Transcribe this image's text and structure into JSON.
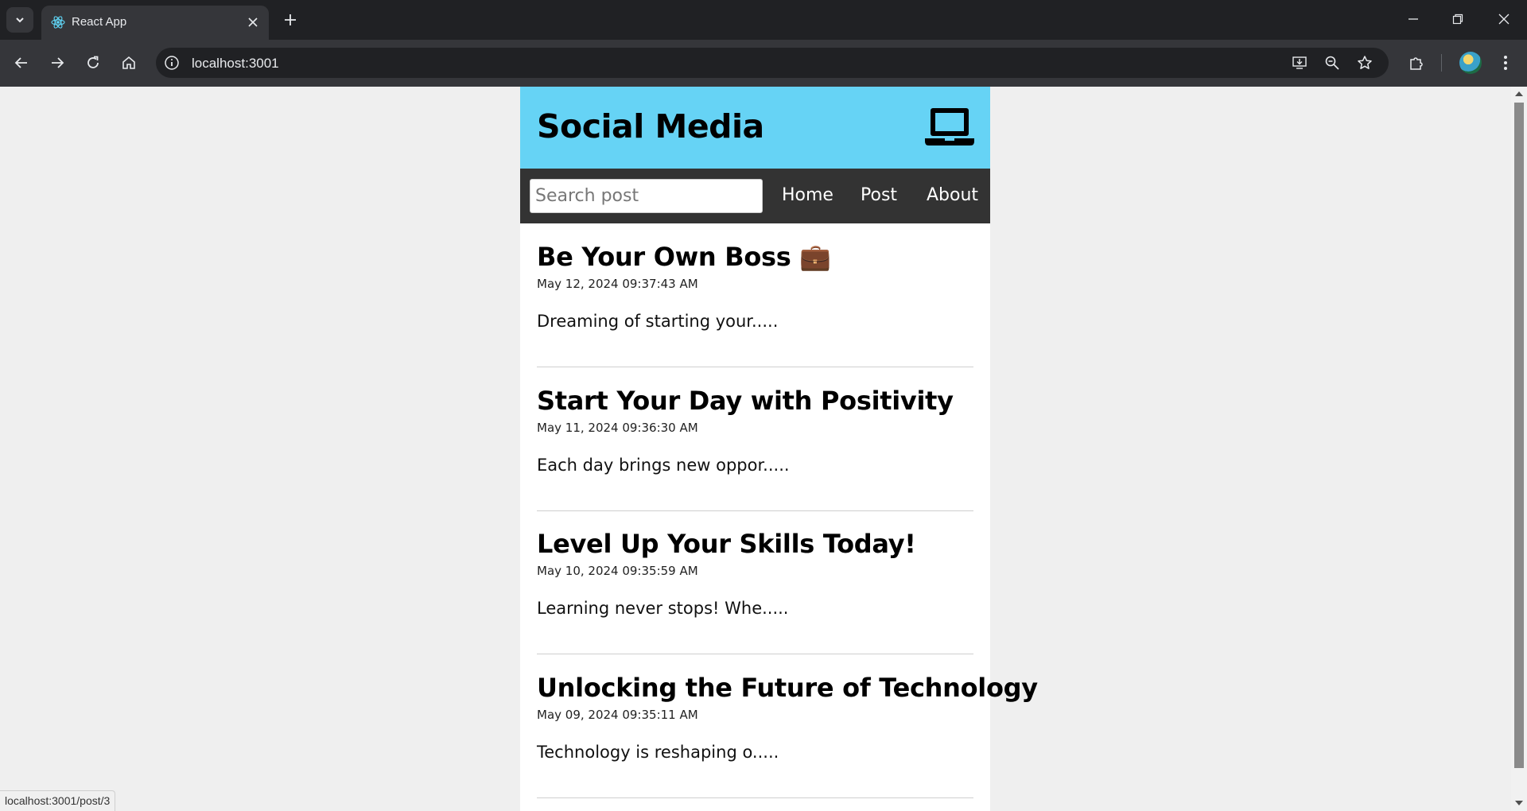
{
  "browser": {
    "tab_title": "React App",
    "url": "localhost:3001",
    "status_url": "localhost:3001/post/3"
  },
  "app": {
    "title": "Social Media",
    "header_color": "#66d3f5",
    "nav_color": "#333333",
    "search_placeholder": "Search post",
    "search_value": "",
    "nav_links": [
      "Home",
      "Post",
      "About"
    ]
  },
  "posts": [
    {
      "title": "Be Your Own Boss 💼",
      "date": "May 12, 2024 09:37:43 AM",
      "excerpt": "Dreaming of starting your....."
    },
    {
      "title": "Start Your Day with Positivity",
      "date": "May 11, 2024 09:36:30 AM",
      "excerpt": "Each day brings new oppor....."
    },
    {
      "title": "Level Up Your Skills Today!",
      "date": "May 10, 2024 09:35:59 AM",
      "excerpt": "Learning never stops! Whe....."
    },
    {
      "title": "Unlocking the Future of Technology",
      "date": "May 09, 2024 09:35:11 AM",
      "excerpt": "Technology is reshaping o....."
    }
  ]
}
